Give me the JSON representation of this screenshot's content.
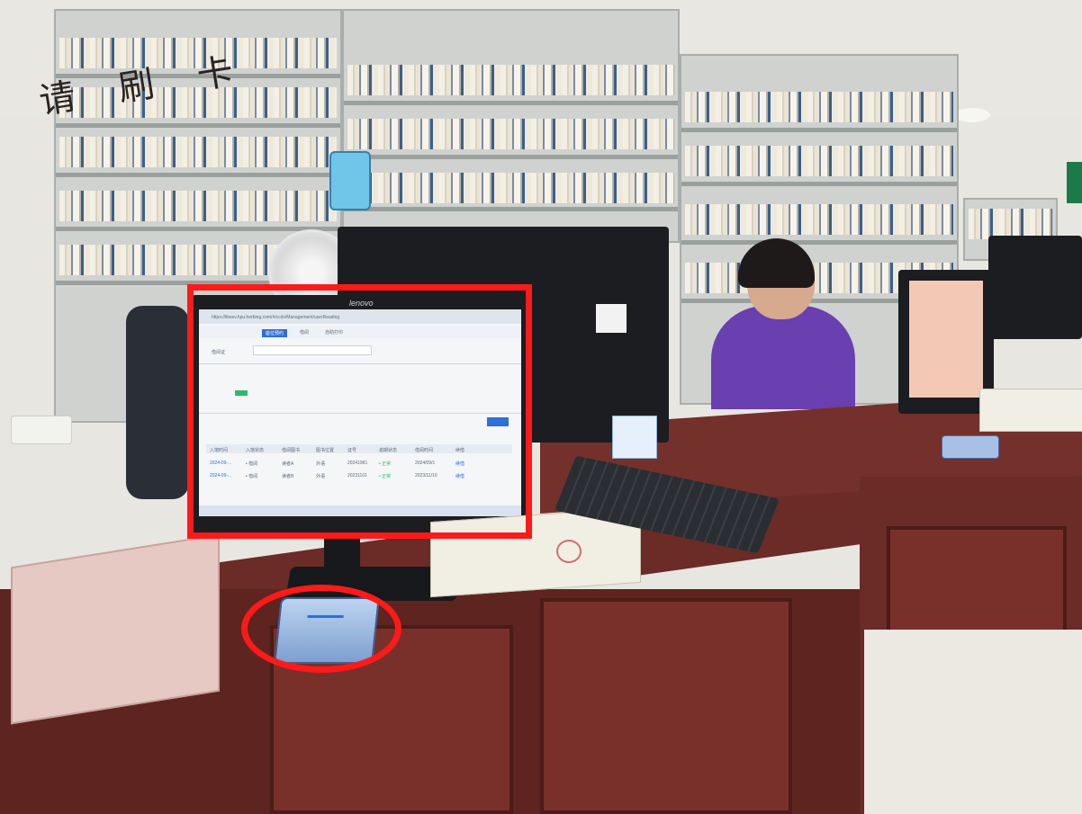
{
  "sign": {
    "text": "请 刷 卡"
  },
  "monitor": {
    "brand": "lenovo",
    "url": "https://libsev.hpu.herbing.com/#/ccdv/Management/userReading",
    "tabs": [
      "座位预约",
      "借阅",
      "自助打印"
    ],
    "record_label": "借阅证",
    "table_headers": [
      "入馆时间",
      "入馆状态",
      "借阅图书",
      "图书位置",
      "证号",
      "逾期状态",
      "借阅时间",
      "续借"
    ],
    "rows": [
      [
        "2024-09-...",
        "• 借阅",
        "读者A",
        "外语",
        "20241981",
        "• 正常",
        "2024/09/1",
        "续借"
      ],
      [
        "2024-09-...",
        "• 借阅",
        "读者B",
        "外语",
        "20231101",
        "• 正常",
        "2023/11/10",
        "续借"
      ]
    ]
  },
  "highlights": {
    "color": "#ff1a1a"
  }
}
